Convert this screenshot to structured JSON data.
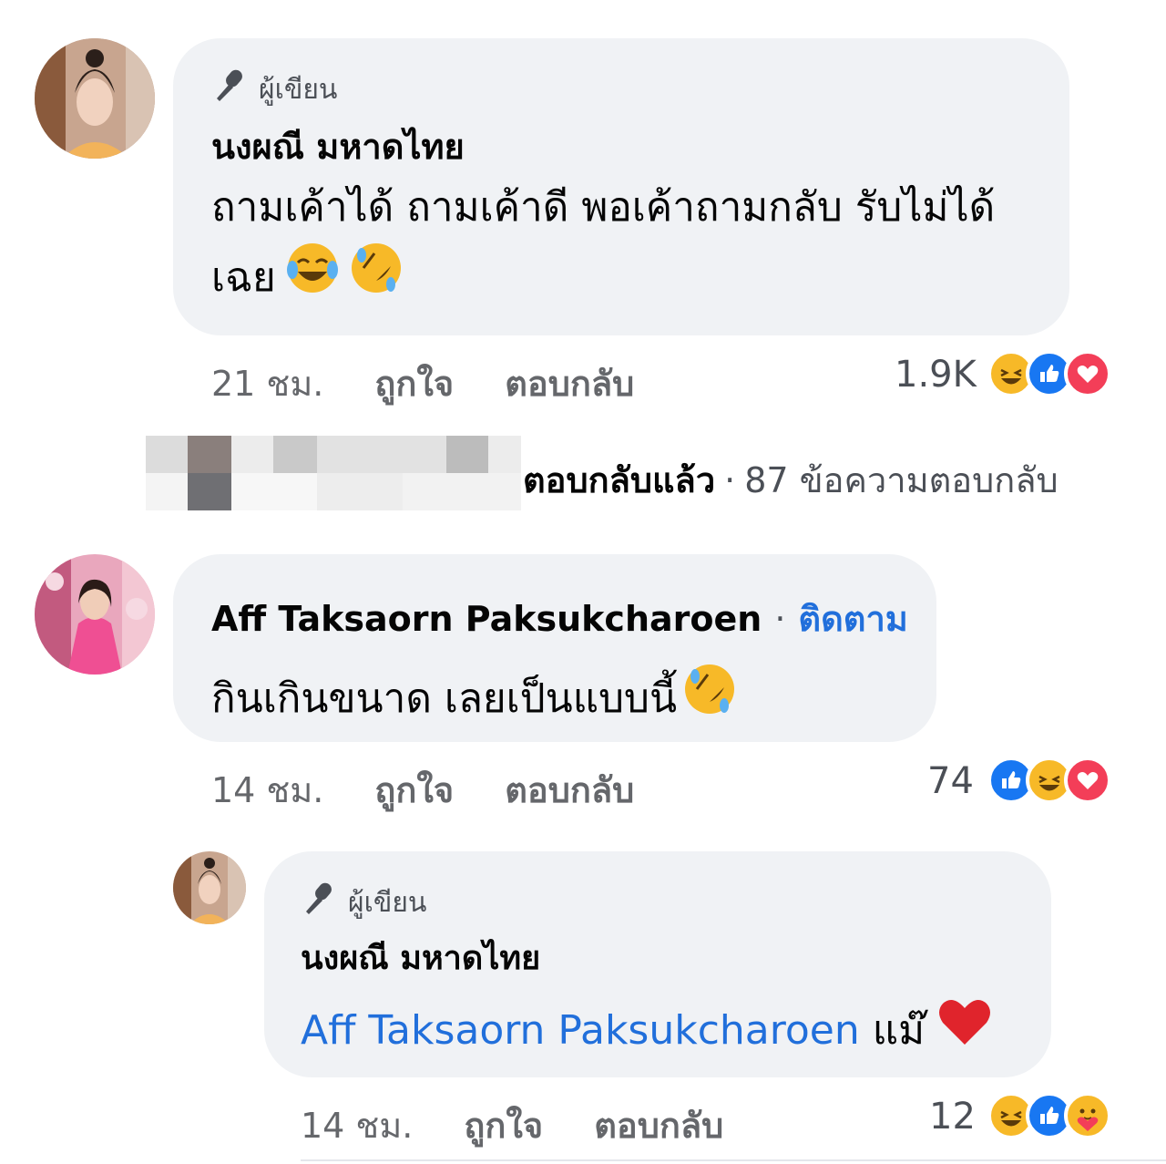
{
  "comments": [
    {
      "author_badge": "ผู้เขียน",
      "author": "นงผณี มหาดไทย",
      "text_line1": "ถามเค้าได้ ถามเค้าดี พอเค้าถามกลับ รับไม่ได้",
      "text_line2": "เฉย",
      "time": "21 ชม.",
      "like": "ถูกใจ",
      "reply": "ตอบกลับ",
      "reaction_count": "1.9K",
      "reactions": [
        "haha-icon",
        "like-icon",
        "love-icon"
      ]
    },
    {
      "author": "Aff Taksaorn Paksukcharoen",
      "follow": "ติดตาม",
      "text": "กินเกินขนาด เลยเป็นแบบนี้",
      "time": "14 ชม.",
      "like": "ถูกใจ",
      "reply": "ตอบกลับ",
      "reaction_count": "74",
      "reactions": [
        "like-icon",
        "haha-icon",
        "love-icon"
      ]
    }
  ],
  "replies_summary": {
    "replied": "ตอบกลับแล้ว",
    "count": "87 ข้อความตอบกลับ"
  },
  "reply": {
    "author_badge": "ผู้เขียน",
    "author": "นงผณี มหาดไทย",
    "mention": "Aff Taksaorn Paksukcharoen",
    "text": "แม๊",
    "time": "14 ชม.",
    "like": "ถูกใจ",
    "reply": "ตอบกลับ",
    "reaction_count": "12",
    "reactions": [
      "haha-icon",
      "like-icon",
      "care-icon"
    ]
  },
  "colors": {
    "bubble": "#f0f2f5",
    "link": "#216fdb",
    "like": "#1877f2",
    "love": "#f33e58",
    "haha": "#f7b928"
  }
}
